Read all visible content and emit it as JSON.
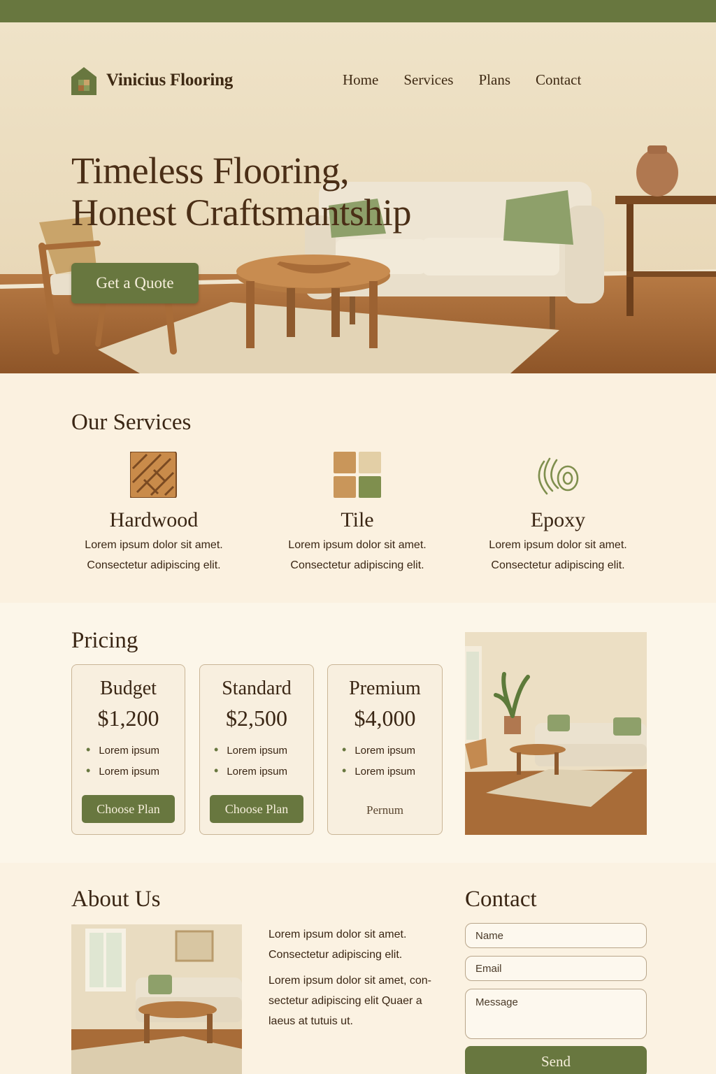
{
  "brand": {
    "name": "Vinicius Flooring"
  },
  "nav": {
    "items": [
      "Home",
      "Services",
      "Plans",
      "Contact"
    ]
  },
  "hero": {
    "title_line1": "Timeless Flooring,",
    "title_line2": "Honest Craftsmantship",
    "cta_label": "Get a Quote"
  },
  "services": {
    "title": "Our Services",
    "items": [
      {
        "name": "Hardwood",
        "line1": "Lorem ipsum dolor sit amet.",
        "line2": "Consectetur adipiscing elit.",
        "icon": "hardwood-icon"
      },
      {
        "name": "Tile",
        "line1": "Lorem ipsum dolor sit amet.",
        "line2": "Consectetur adipiscing elit.",
        "icon": "tile-icon"
      },
      {
        "name": "Epoxy",
        "line1": "Lorem ipsum dolor sit amet.",
        "line2": "Consectetur adipiscing elit.",
        "icon": "epoxy-icon"
      }
    ]
  },
  "pricing": {
    "title": "Pricing",
    "plans": [
      {
        "name": "Budget",
        "price": "$1,200",
        "features": [
          "Lorem ipsum",
          "Lorem ipsum"
        ],
        "button": "Choose Plan"
      },
      {
        "name": "Standard",
        "price": "$2,500",
        "features": [
          "Lorem ipsum",
          "Lorem ipsum"
        ],
        "button": "Choose Plan"
      },
      {
        "name": "Premium",
        "price": "$4,000",
        "features": [
          "Lorem ipsum",
          "Lorem ipsum"
        ],
        "footer_text": "Pernum"
      }
    ]
  },
  "about": {
    "title": "About Us",
    "para1_line1": "Lorem ipsum dolor sit amet.",
    "para1_line2": "Consectetur adipiscing elit.",
    "para2": "Lorem ipsum dolor sit amet, con-sectetur adipiscing elit Quaer a laeus at tutuis ut."
  },
  "contact": {
    "title": "Contact",
    "name_placeholder": "Name",
    "email_placeholder": "Email",
    "message_placeholder": "Message",
    "send_label": "Send"
  },
  "colors": {
    "accent": "#68773f",
    "background": "#fbf4e6",
    "text": "#3a2614"
  }
}
